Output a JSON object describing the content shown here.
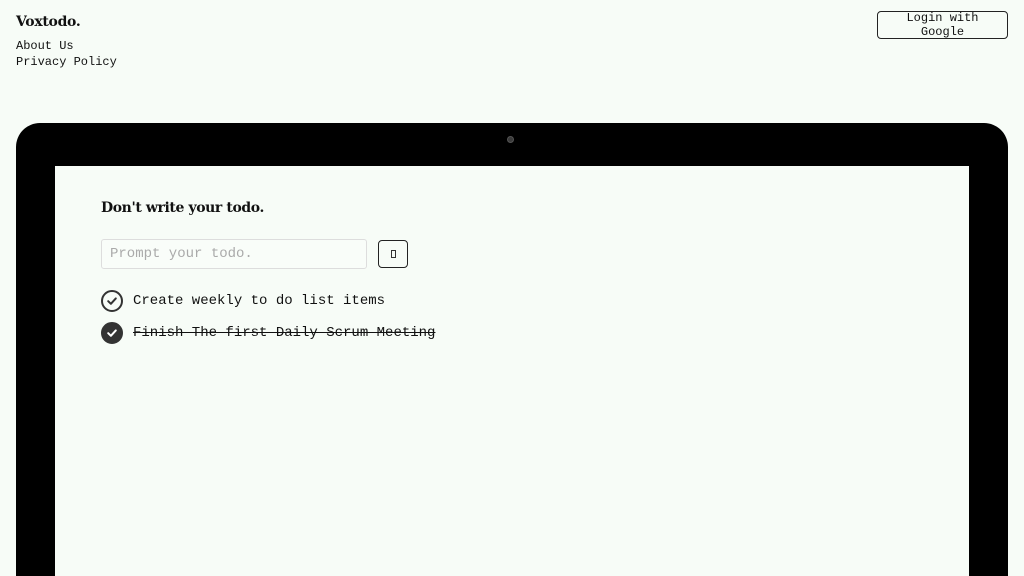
{
  "header": {
    "brand": "Voxtodo.",
    "nav": {
      "about": "About Us",
      "privacy": "Privacy Policy"
    },
    "login_label": "Login with Google"
  },
  "main": {
    "headline": "Don't write your todo.",
    "input": {
      "placeholder": "Prompt your todo.",
      "value": ""
    },
    "mic_button_glyph": "",
    "todos": [
      {
        "text": "Create weekly to do list items",
        "done": false
      },
      {
        "text": "Finish The first Daily Scrum Meeting",
        "done": true
      }
    ]
  }
}
